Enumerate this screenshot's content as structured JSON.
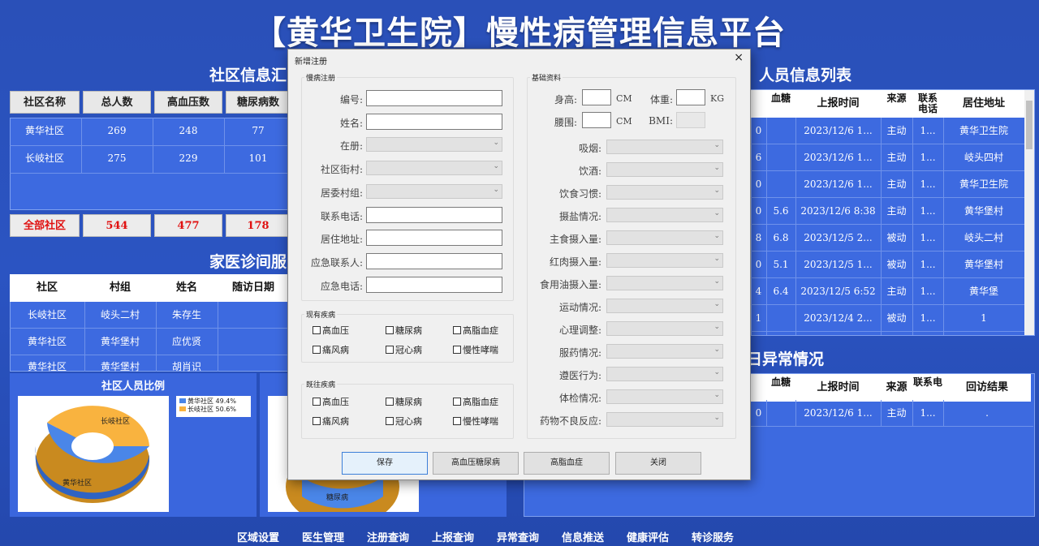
{
  "title": "【黄华卫生院】慢性病管理信息平台",
  "sections": {
    "community_summary": "社区信息汇",
    "family_doctor": "家医诊间服",
    "pie_left_title": "社区人员比例",
    "personnel_list": "人员信息列表",
    "abnormal": "日异常情况"
  },
  "community_table": {
    "headers": [
      "社区名称",
      "总人数",
      "高血压数",
      "糖尿病数"
    ],
    "rows": [
      [
        "黄华社区",
        "269",
        "248",
        "77"
      ],
      [
        "长岐社区",
        "275",
        "229",
        "101"
      ]
    ],
    "total": [
      "全部社区",
      "544",
      "477",
      "178"
    ]
  },
  "family_table": {
    "headers": [
      "社区",
      "村组",
      "姓名",
      "随访日期"
    ],
    "rows": [
      [
        "长岐社区",
        "岐头二村",
        "朱存生"
      ],
      [
        "黄华社区",
        "黄华堡村",
        "应优贤"
      ],
      [
        "黄华社区",
        "黄华堡村",
        "胡肖识"
      ]
    ]
  },
  "pie_left": {
    "legend": [
      "黄华社区 49.4%",
      "长岐社区 50.6%"
    ],
    "labels": [
      "长岐社区",
      "黄华社区"
    ],
    "colors": [
      "#4a86e8",
      "#f9b33f"
    ]
  },
  "pie_right": {
    "label": "糖尿病"
  },
  "personnel_table": {
    "headers": [
      "血糖",
      "上报时间",
      "来源",
      "联系电话",
      "居住地址"
    ],
    "rows": [
      [
        "0",
        "",
        "2023/12/6 1...",
        "主动",
        "1...",
        "黄华卫生院"
      ],
      [
        "6",
        "",
        "2023/12/6 1...",
        "主动",
        "1...",
        "岐头四村"
      ],
      [
        "0",
        "",
        "2023/12/6 1...",
        "主动",
        "1...",
        "黄华卫生院"
      ],
      [
        "0",
        "5.6",
        "2023/12/6 8:38",
        "主动",
        "1...",
        "黄华堡村"
      ],
      [
        "8",
        "6.8",
        "2023/12/5 2...",
        "被动",
        "1...",
        "岐头二村"
      ],
      [
        "0",
        "5.1",
        "2023/12/5 1...",
        "被动",
        "1...",
        "黄华堡村"
      ],
      [
        "4",
        "6.4",
        "2023/12/5 6:52",
        "主动",
        "1...",
        "黄华堡"
      ],
      [
        "1",
        "",
        "2023/12/4 2...",
        "被动",
        "1...",
        "1"
      ]
    ]
  },
  "abnormal_table": {
    "headers": [
      "血糖",
      "上报时间",
      "来源",
      "联系电",
      "回访结果"
    ],
    "rows": [
      [
        "0",
        "",
        "2023/12/6 1...",
        "主动",
        "1...",
        "."
      ]
    ]
  },
  "nav": [
    "区域设置",
    "医生管理",
    "注册查询",
    "上报查询",
    "异常查询",
    "信息推送",
    "健康评估",
    "转诊服务"
  ],
  "dialog": {
    "title": "新增注册",
    "close": "×",
    "reg_group": "慢病注册",
    "reg_fields": [
      "编号:",
      "姓名:",
      "在册:",
      "社区街村:",
      "居委村组:",
      "联系电话:",
      "居住地址:",
      "应急联系人:",
      "应急电话:"
    ],
    "basic_group": "基础资料",
    "height_label": "身高:",
    "height_unit": "CM",
    "weight_label": "体重:",
    "weight_unit": "KG",
    "waist_label": "腰围:",
    "waist_unit": "CM",
    "bmi_label": "BMI:",
    "basic_fields": [
      "吸烟:",
      "饮酒:",
      "饮食习惯:",
      "摄盐情况:",
      "主食摄入量:",
      "红肉摄入量:",
      "食用油摄入量:",
      "运动情况:",
      "心理调整:",
      "服药情况:",
      "遵医行为:",
      "体检情况:",
      "药物不良反应:"
    ],
    "current_group": "现有疾病",
    "past_group": "既往疾病",
    "diseases": [
      "高血压",
      "糖尿病",
      "高脂血症",
      "痛风病",
      "冠心病",
      "慢性哮喘"
    ],
    "buttons": [
      "保存",
      "高血压糖尿病",
      "高脂血症",
      "关闭"
    ]
  }
}
